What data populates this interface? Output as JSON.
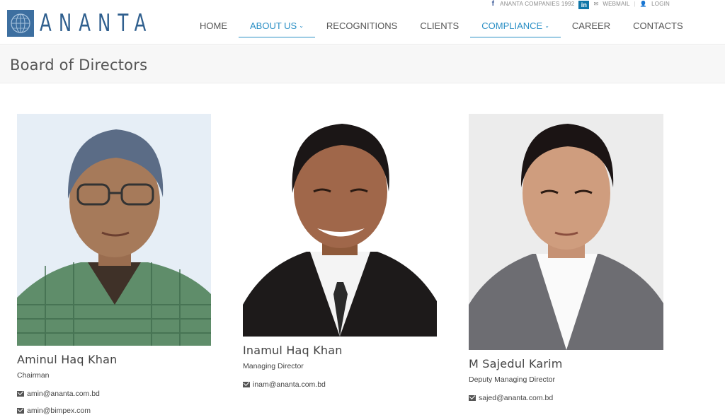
{
  "topbar": {
    "companies": "ANANTA COMPANIES 1992",
    "linkedin": "in",
    "webmail": "WEBMAIL",
    "login": "LOGIN"
  },
  "logo": {
    "text": "ANANTA"
  },
  "nav": {
    "items": [
      {
        "label": "HOME"
      },
      {
        "label": "ABOUT US",
        "caret": "⌄"
      },
      {
        "label": "RECOGNITIONS"
      },
      {
        "label": "CLIENTS"
      },
      {
        "label": "COMPLIANCE",
        "caret": "⌄"
      },
      {
        "label": "CAREER"
      },
      {
        "label": "CONTACTS"
      }
    ],
    "active_color": "#2a8fc5"
  },
  "page": {
    "title": "Board of Directors"
  },
  "directors": [
    {
      "name": "Aminul Haq Khan",
      "role": "Chairman",
      "emails": [
        "amin@ananta.com.bd",
        "amin@bimpex.com"
      ]
    },
    {
      "name": "Inamul Haq Khan",
      "role": "Managing Director",
      "emails": [
        "inam@ananta.com.bd"
      ]
    },
    {
      "name": "M Sajedul Karim",
      "role": "Deputy Managing Director",
      "emails": [
        "sajed@ananta.com.bd"
      ]
    }
  ],
  "colors": {
    "brand": "#2f5f8e",
    "accent": "#2a8fc5"
  }
}
